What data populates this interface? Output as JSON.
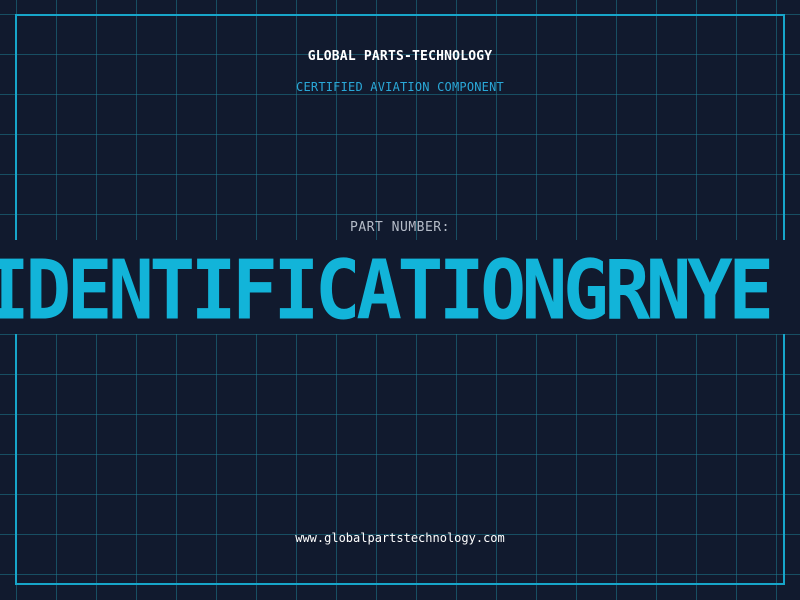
{
  "header": {
    "title": "GLOBAL PARTS-TECHNOLOGY",
    "subtitle": "CERTIFIED AVIATION COMPONENT"
  },
  "part": {
    "label": "PART NUMBER:",
    "number": "IDENTIFICATIONGRNYE"
  },
  "footer": {
    "url": "www.globalpartstechnology.com"
  },
  "colors": {
    "background": "#111a2e",
    "grid": "#1c788c",
    "accent": "#12b4d9",
    "frame": "#17a5c9",
    "subtitle": "#2aa8d8",
    "label": "#b5bcc8",
    "text": "#ffffff"
  }
}
